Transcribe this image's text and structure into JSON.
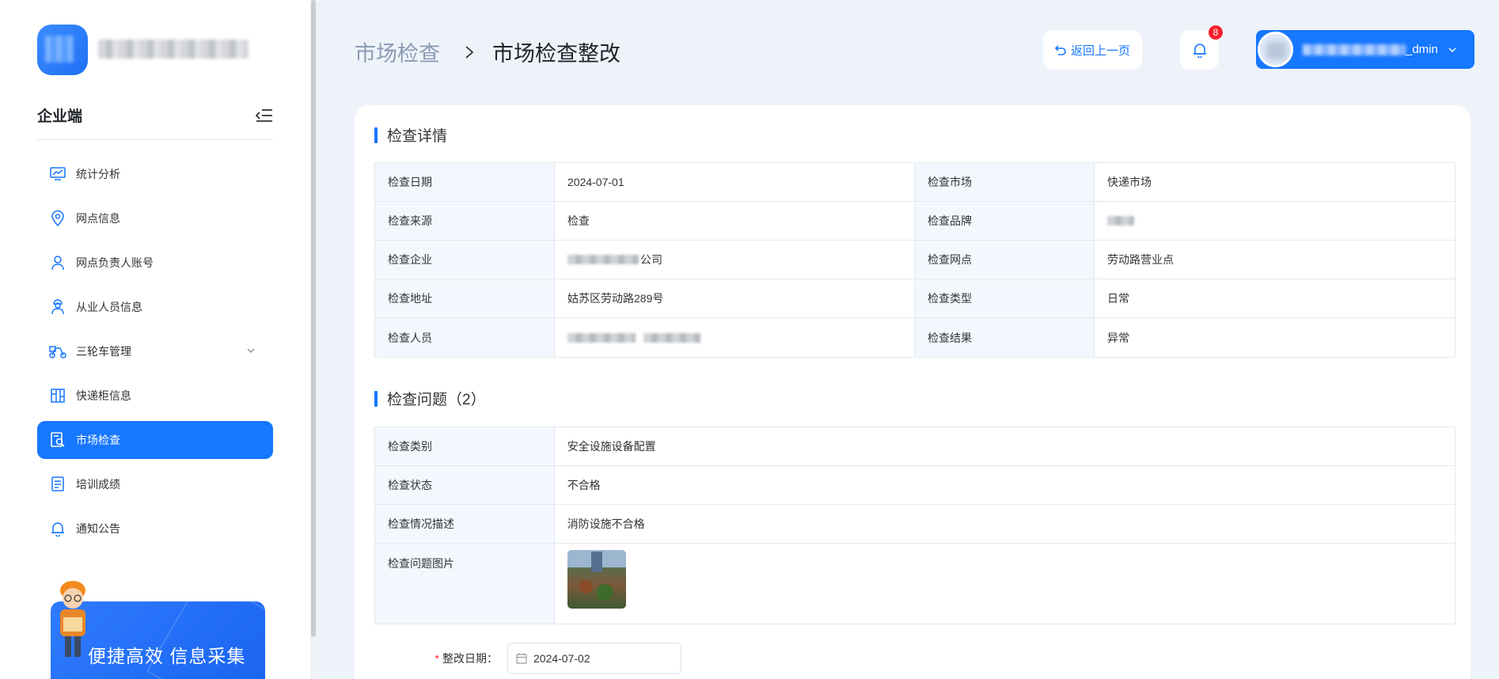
{
  "sidebar": {
    "title": "企业端",
    "menu": [
      {
        "label": "统计分析",
        "icon": "chart-icon"
      },
      {
        "label": "网点信息",
        "icon": "location-icon"
      },
      {
        "label": "网点负责人账号",
        "icon": "user-icon"
      },
      {
        "label": "从业人员信息",
        "icon": "worker-icon"
      },
      {
        "label": "三轮车管理",
        "icon": "tricycle-icon"
      },
      {
        "label": "快递柜信息",
        "icon": "locker-icon"
      },
      {
        "label": "市场检查",
        "icon": "inspect-icon"
      },
      {
        "label": "培训成绩",
        "icon": "certificate-icon"
      },
      {
        "label": "通知公告",
        "icon": "bell-icon"
      }
    ],
    "promo_text": "便捷高效 信息采集"
  },
  "header": {
    "breadcrumb_parent": "市场检查",
    "breadcrumb_current": "市场检查整改",
    "back_label": "返回上一页",
    "notification_count": "8",
    "user_suffix": "_dmin"
  },
  "detail": {
    "title": "检查详情",
    "rows": [
      {
        "l1": "检查日期",
        "v1": "2024-07-01",
        "l2": "检查市场",
        "v2": "快递市场"
      },
      {
        "l1": "检查来源",
        "v1": "检查",
        "l2": "检查品牌",
        "v2": ""
      },
      {
        "l1": "检查企业",
        "v1": "公司",
        "l2": "检查网点",
        "v2": "劳动路营业点"
      },
      {
        "l1": "检查地址",
        "v1": "姑苏区劳动路289号",
        "l2": "检查类型",
        "v2": "日常"
      },
      {
        "l1": "检查人员",
        "v1": "",
        "l2": "检查结果",
        "v2": "异常"
      }
    ]
  },
  "issues": {
    "title": "检查问题（2）",
    "rows": [
      {
        "label": "检查类别",
        "value": "安全设施设备配置"
      },
      {
        "label": "检查状态",
        "value": "不合格"
      },
      {
        "label": "检查情况描述",
        "value": "消防设施不合格"
      },
      {
        "label": "检查问题图片",
        "value": ""
      }
    ]
  },
  "form": {
    "rectify_date_label": "整改日期：",
    "rectify_date_value": "2024-07-02"
  },
  "colors": {
    "primary": "#1677ff",
    "badge": "#f5222d",
    "bg": "#eef3fa"
  }
}
